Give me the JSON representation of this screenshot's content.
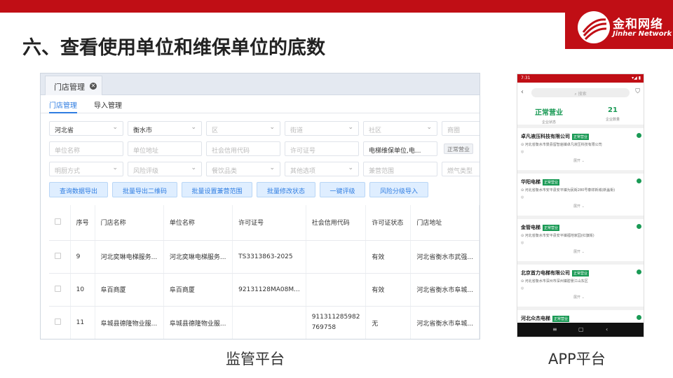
{
  "slide": {
    "title": "六、查看使用单位和维保单位的底数",
    "logo_cn": "金和网络",
    "logo_en": "Jinher Network",
    "brand_color": "#c00e15",
    "caption_left": "监管平台",
    "caption_right": "APP平台"
  },
  "web": {
    "tab_label": "门店管理",
    "tab_close_icon": "close-icon",
    "subtabs": [
      "门店管理",
      "导入管理"
    ],
    "filters_row1": [
      {
        "value": "河北省",
        "filled": true,
        "dropdown": true
      },
      {
        "value": "衡水市",
        "filled": true,
        "dropdown": true
      },
      {
        "value": "区",
        "filled": false,
        "dropdown": true
      },
      {
        "value": "街道",
        "filled": false,
        "dropdown": true
      },
      {
        "value": "社区",
        "filled": false,
        "dropdown": true
      },
      {
        "value": "商圈",
        "filled": false,
        "dropdown": false
      }
    ],
    "filters_row2": [
      {
        "value": "单位名称",
        "filled": false
      },
      {
        "value": "单位地址",
        "filled": false
      },
      {
        "value": "社会信用代码",
        "filled": false
      },
      {
        "value": "许可证号",
        "filled": false
      },
      {
        "value": "电梯维保单位,电...",
        "filled": true
      }
    ],
    "row2_tag": "正常营业",
    "filters_row3": [
      {
        "value": "明厨方式",
        "filled": false,
        "dropdown": true
      },
      {
        "value": "风险评级",
        "filled": false,
        "dropdown": true
      },
      {
        "value": "餐饮品类",
        "filled": false,
        "dropdown": true
      },
      {
        "value": "其他选项",
        "filled": false,
        "dropdown": true
      },
      {
        "value": "兼营范围",
        "filled": false,
        "dropdown": false
      },
      {
        "value": "燃气类型",
        "filled": false,
        "dropdown": false
      }
    ],
    "buttons": [
      "查询数据导出",
      "批量导出二维码",
      "批量设置兼营范围",
      "批量修改状态",
      "一键评级",
      "风险分级导入"
    ],
    "accent_color": "#2f7de1",
    "table": {
      "headers": [
        "序号",
        "门店名称",
        "单位名称",
        "许可证号",
        "社会信用代码",
        "许可证状态",
        "门店地址"
      ],
      "rows": [
        {
          "no": "9",
          "store": "河北奕琳电梯服务...",
          "unit": "河北奕琳电梯服务...",
          "license": "TS3313863-2025",
          "credit": "",
          "status": "有效",
          "address": "河北省衡水市武强..."
        },
        {
          "no": "10",
          "store": "阜百商厦",
          "unit": "阜百商厦",
          "license": "92131128MA08M...",
          "credit": "",
          "status": "有效",
          "address": "河北省衡水市阜城..."
        },
        {
          "no": "11",
          "store": "阜城县德隆物业服...",
          "unit": "阜城县德隆物业服...",
          "license": "",
          "credit": "911311285982 769758",
          "status": "无",
          "address": "河北省衡水市阜城..."
        }
      ]
    }
  },
  "app": {
    "status_time": "7:31",
    "status_right": "▾◢ ▮",
    "search_placeholder": "搜索",
    "stats": [
      {
        "value": "正常营业",
        "label": "企业状态"
      },
      {
        "value": "21",
        "label": "企业数量"
      }
    ],
    "status_color": "#1a9a55",
    "badge": "正常营业",
    "expand_label": "展开 ⌄",
    "cards": [
      {
        "name": "卓凡液压科技有限公司",
        "address": "河北省衡水市景县留智庙镇卓凡液压科技有限公司"
      },
      {
        "name": "华阳电梯",
        "address": "河北省衡水市安平县安平镇为民街280号泰祥新城(新盖街)"
      },
      {
        "name": "金管电梯",
        "address": "河北省衡水市安平县安平镇福地家园(红旗街)"
      },
      {
        "name": "北京首力电梯有限公司",
        "address": "河北省衡水市深州市深州镇碧景江山东区"
      },
      {
        "name": "河北众杰电梯",
        "address": ""
      }
    ],
    "nav": [
      "≡",
      "▢",
      "‹"
    ]
  }
}
